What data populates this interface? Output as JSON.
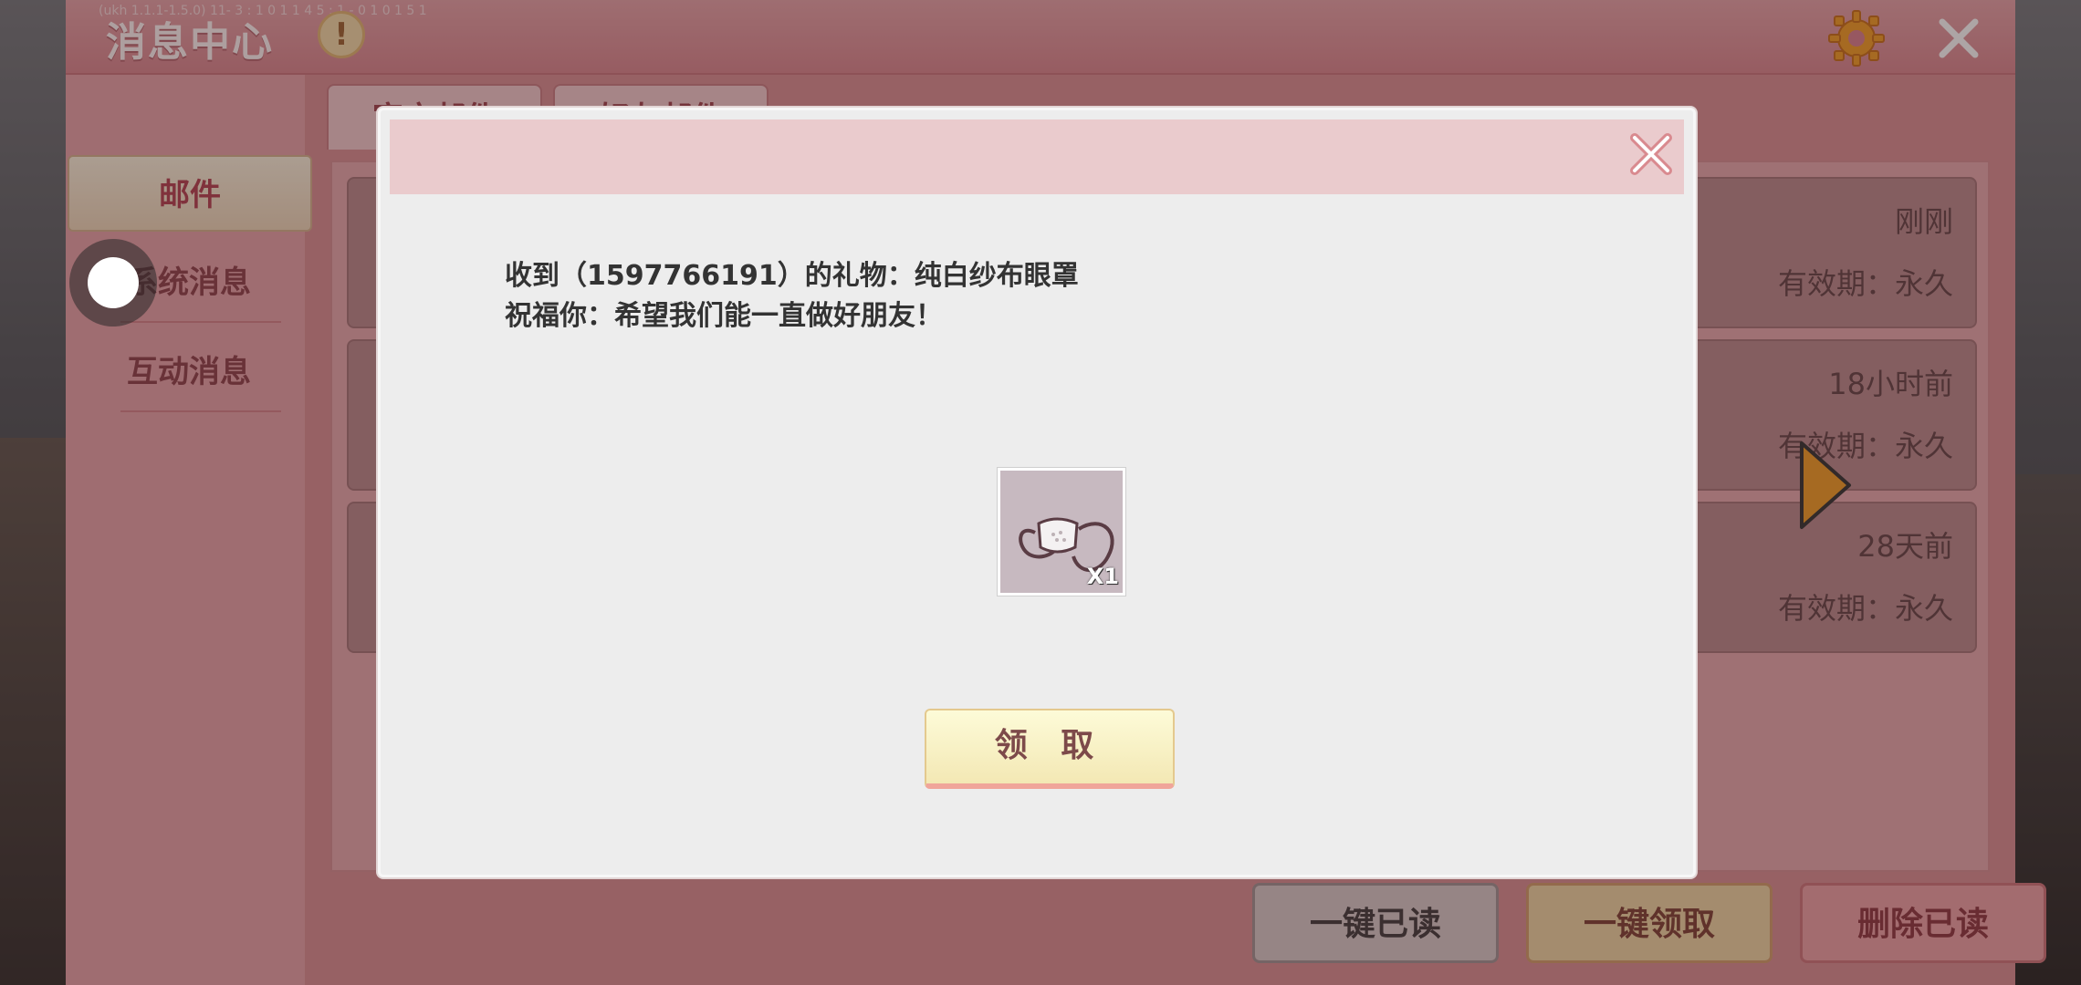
{
  "panel": {
    "title": "消息中心",
    "header_deco": "(ukh 1.1.1-1.5.0) 11- 3 : 1 0 1 1 4 5 : 1 - 0 1 0 1 5 1",
    "alert_badge": "!",
    "tabs": [
      "官方邮件",
      "好友邮件"
    ],
    "sidebar": [
      {
        "label": "邮件",
        "active": true
      },
      {
        "label": "系统消息",
        "active": false
      },
      {
        "label": "互动消息",
        "active": false
      }
    ],
    "mail_rows": [
      {
        "time": "刚刚",
        "valid": "有效期：永久"
      },
      {
        "time": "18小时前",
        "valid": "有效期：永久"
      },
      {
        "time": "28天前",
        "valid": "有效期：永久"
      }
    ],
    "bottom_buttons": {
      "read_all": "一键已读",
      "claim_all": "一键领取",
      "delete_read": "删除已读"
    }
  },
  "modal": {
    "line1": "收到（1597766191）的礼物：纯白纱布眼罩",
    "line2": "祝福你：希望我们能一直做好朋友！",
    "gift": {
      "icon": "eye-mask-icon",
      "quantity": "X1"
    },
    "claim_label": "领 取"
  },
  "colors": {
    "panel": "#d98a8f",
    "modal_bg": "#ededed",
    "modal_header": "#eacbcd",
    "accent_orange": "#f39a1e"
  }
}
